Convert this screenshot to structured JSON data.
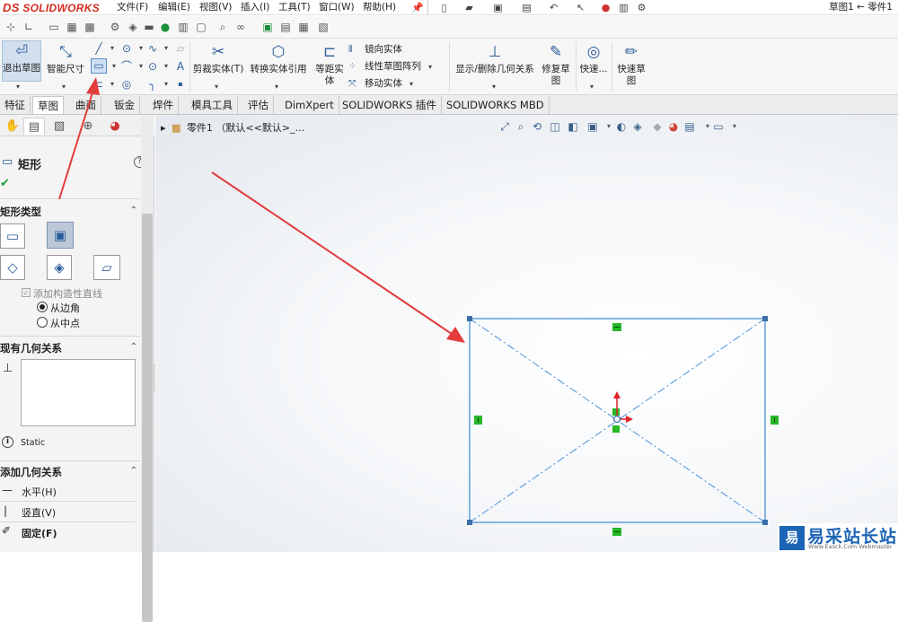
{
  "app": {
    "brand": "SOLIDWORKS",
    "brand_prefix": "DS",
    "document_title": "草图1 ← 零件1"
  },
  "menu": [
    "文件(F)",
    "编辑(E)",
    "视图(V)",
    "插入(I)",
    "工具(T)",
    "窗口(W)",
    "帮助(H)"
  ],
  "ribbon": {
    "exit_sketch": "退出草图",
    "smart_dim": "智能尺寸",
    "trim": "剪裁实体(T)",
    "convert": "转换实体引用",
    "offset_line1": "等距实",
    "offset_line2": "体",
    "mirror": "镜向实体",
    "linear_pattern": "线性草图阵列",
    "move": "移动实体",
    "show_relations": "显示/删除几何关系",
    "repair_line1": "修复草",
    "repair_line2": "图",
    "quick_snap": "快速...",
    "quick_sketch_line1": "快速草",
    "quick_sketch_line2": "图"
  },
  "tabs": [
    "特征",
    "草图",
    "曲面",
    "钣金",
    "焊件",
    "模具工具",
    "评估",
    "DimXpert",
    "SOLIDWORKS 插件",
    "SOLIDWORKS MBD"
  ],
  "active_tab": "草图",
  "panel": {
    "title": "矩形",
    "help": "?",
    "ok": "✔",
    "rect_type": {
      "heading": "矩形类型",
      "add_construction": "添加构造性直线",
      "from_corner": "从边角",
      "from_center": "从中点",
      "selected": "从边角"
    },
    "existing_relations": {
      "heading": "现有几何关系",
      "status": "Static"
    },
    "add_relations": {
      "heading": "添加几何关系",
      "items": [
        "水平(H)",
        "竖直(V)",
        "固定(F)"
      ]
    }
  },
  "tree": {
    "expand": "▸",
    "label": "零件1 （默认<<默认>_..."
  },
  "colors": {
    "sketch_line": "#4a90d9",
    "relation_green": "#28b828",
    "origin_red": "#e0202a",
    "arrow_red": "#e23c3c",
    "accent_blue": "#2b5c9a"
  },
  "watermark": {
    "badge": "易",
    "name": "易采站长站",
    "url": "Www.Easck.Com  Webmaster"
  }
}
